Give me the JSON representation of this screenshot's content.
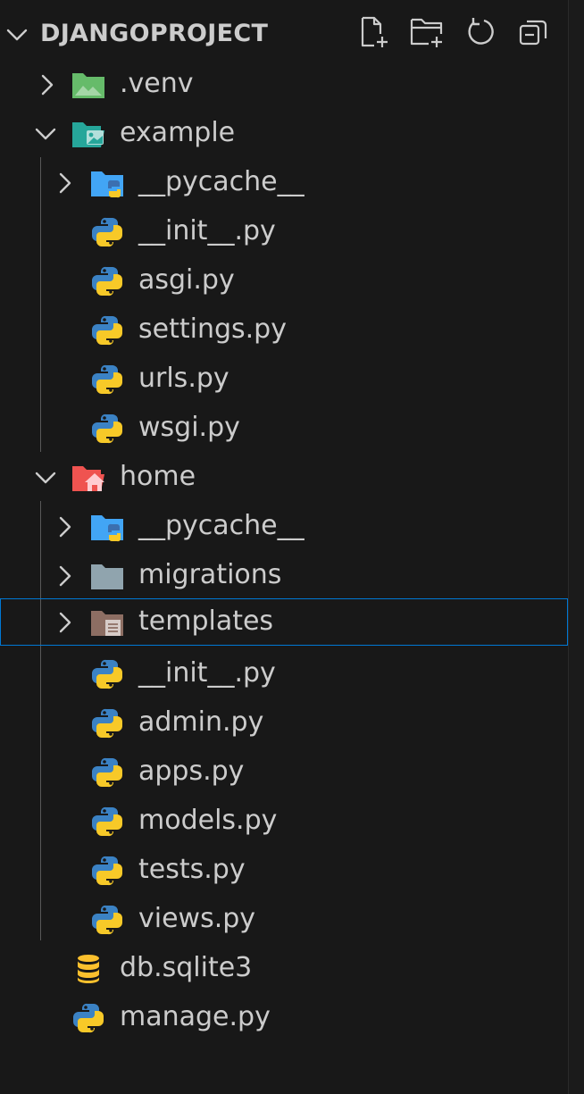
{
  "explorer": {
    "project_title": "DJANGOPROJECT",
    "actions": [
      {
        "name": "new-file-icon"
      },
      {
        "name": "new-folder-icon"
      },
      {
        "name": "refresh-icon"
      },
      {
        "name": "collapse-all-icon"
      }
    ],
    "items": [
      {
        "label": ".venv",
        "kind": "folder",
        "icon": "venv-folder-icon",
        "expanded": false
      },
      {
        "label": "example",
        "kind": "folder",
        "icon": "example-folder-icon",
        "expanded": true
      },
      {
        "label": "__pycache__",
        "kind": "folder",
        "icon": "python-folder-icon",
        "expanded": false
      },
      {
        "label": "__init__.py",
        "kind": "file",
        "icon": "python-icon"
      },
      {
        "label": "asgi.py",
        "kind": "file",
        "icon": "python-icon"
      },
      {
        "label": "settings.py",
        "kind": "file",
        "icon": "python-icon"
      },
      {
        "label": "urls.py",
        "kind": "file",
        "icon": "python-icon"
      },
      {
        "label": "wsgi.py",
        "kind": "file",
        "icon": "python-icon"
      },
      {
        "label": "home",
        "kind": "folder",
        "icon": "home-folder-icon",
        "expanded": true
      },
      {
        "label": "__pycache__",
        "kind": "folder",
        "icon": "python-folder-icon",
        "expanded": false
      },
      {
        "label": "migrations",
        "kind": "folder",
        "icon": "folder-icon",
        "expanded": false
      },
      {
        "label": "templates",
        "kind": "folder",
        "icon": "templates-folder-icon",
        "expanded": false,
        "selected": true
      },
      {
        "label": "__init__.py",
        "kind": "file",
        "icon": "python-icon"
      },
      {
        "label": "admin.py",
        "kind": "file",
        "icon": "python-icon"
      },
      {
        "label": "apps.py",
        "kind": "file",
        "icon": "python-icon"
      },
      {
        "label": "models.py",
        "kind": "file",
        "icon": "python-icon"
      },
      {
        "label": "tests.py",
        "kind": "file",
        "icon": "python-icon"
      },
      {
        "label": "views.py",
        "kind": "file",
        "icon": "python-icon"
      },
      {
        "label": "db.sqlite3",
        "kind": "file",
        "icon": "database-icon"
      },
      {
        "label": "manage.py",
        "kind": "file",
        "icon": "python-icon"
      }
    ]
  },
  "colors": {
    "background": "#181818",
    "text": "#cccccc",
    "selection_border": "#0078d4",
    "python_blue": "#3b82c4",
    "python_yellow": "#f7c928"
  }
}
